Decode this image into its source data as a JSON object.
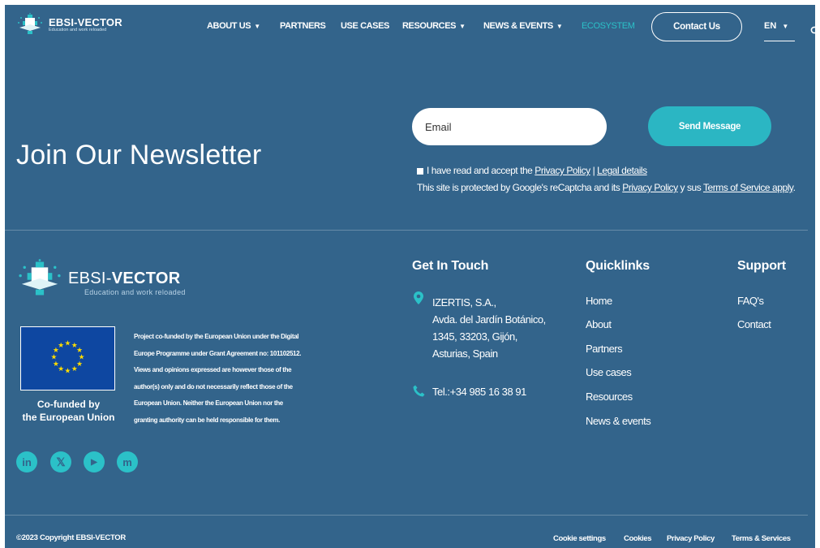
{
  "brand": {
    "name_part1": "EBSI-",
    "name_part2": "VECTOR",
    "tagline": "Education and work reloaded"
  },
  "nav": {
    "items": [
      {
        "label": "ABOUT US",
        "has_dropdown": true
      },
      {
        "label": "PARTNERS",
        "has_dropdown": false
      },
      {
        "label": "USE CASES",
        "has_dropdown": false
      },
      {
        "label": "RESOURCES",
        "has_dropdown": true
      },
      {
        "label": "NEWS & EVENTS",
        "has_dropdown": true
      },
      {
        "label": "ECOSYSTEM",
        "has_dropdown": false
      }
    ],
    "contact_button": "Contact Us",
    "language": "EN"
  },
  "newsletter": {
    "title": "Join Our Newsletter",
    "email_placeholder": "Email",
    "send_button": "Send Message",
    "consent_prefix": "I have read and accept the",
    "privacy_link": "Privacy Policy",
    "separator": "|",
    "legal_link": "Legal details",
    "recaptcha_prefix": "This site is protected by Google's reCaptcha and its",
    "recaptcha_privacy_link": "Privacy Policy",
    "recaptcha_middle": "y sus",
    "terms_link": "Terms of Service apply",
    "recaptcha_suffix": "."
  },
  "footer": {
    "eu": {
      "caption_line1": "Co-funded by",
      "caption_line2": "the European Union",
      "disclaimer_lines": [
        "Project co-funded by the European Union under the Digital",
        "Europe Programme under Grant Agreement no: 101102512.",
        "Views and opinions expressed are however those of the",
        "author(s) only and do not necessarily reflect those of the",
        "European Union. Neither the European Union nor the",
        "granting authority can be held responsible for them."
      ]
    },
    "social": [
      {
        "icon": "linkedin-icon",
        "glyph": "in"
      },
      {
        "icon": "x-icon",
        "glyph": "𝕏"
      },
      {
        "icon": "youtube-icon",
        "glyph": "▶"
      },
      {
        "icon": "mastodon-icon",
        "glyph": "m"
      }
    ],
    "get_in_touch": {
      "title": "Get In Touch",
      "address_lines": [
        "IZERTIS, S.A.,",
        "Avda. del Jardín Botánico,",
        "1345, 33203, Gijón,",
        "Asturias, Spain"
      ],
      "phone": "Tel.:+34 985 16 38 91"
    },
    "quicklinks": {
      "title": "Quicklinks",
      "items": [
        "Home",
        "About",
        "Partners",
        "Use cases",
        "Resources",
        "News & events"
      ]
    },
    "support": {
      "title": "Support",
      "items": [
        "FAQ's",
        "Contact"
      ]
    },
    "copyright": "©2023 Copyright EBSI-VECTOR",
    "bottom_links": [
      "Cookie settings",
      "Cookies",
      "Privacy Policy",
      "Terms & Services"
    ]
  },
  "colors": {
    "background": "#33648b",
    "accent": "#2bb6c3",
    "ecosystem_link": "#2bc1c8",
    "eu_blue": "#0e47a1",
    "eu_star": "#ffdd00"
  }
}
